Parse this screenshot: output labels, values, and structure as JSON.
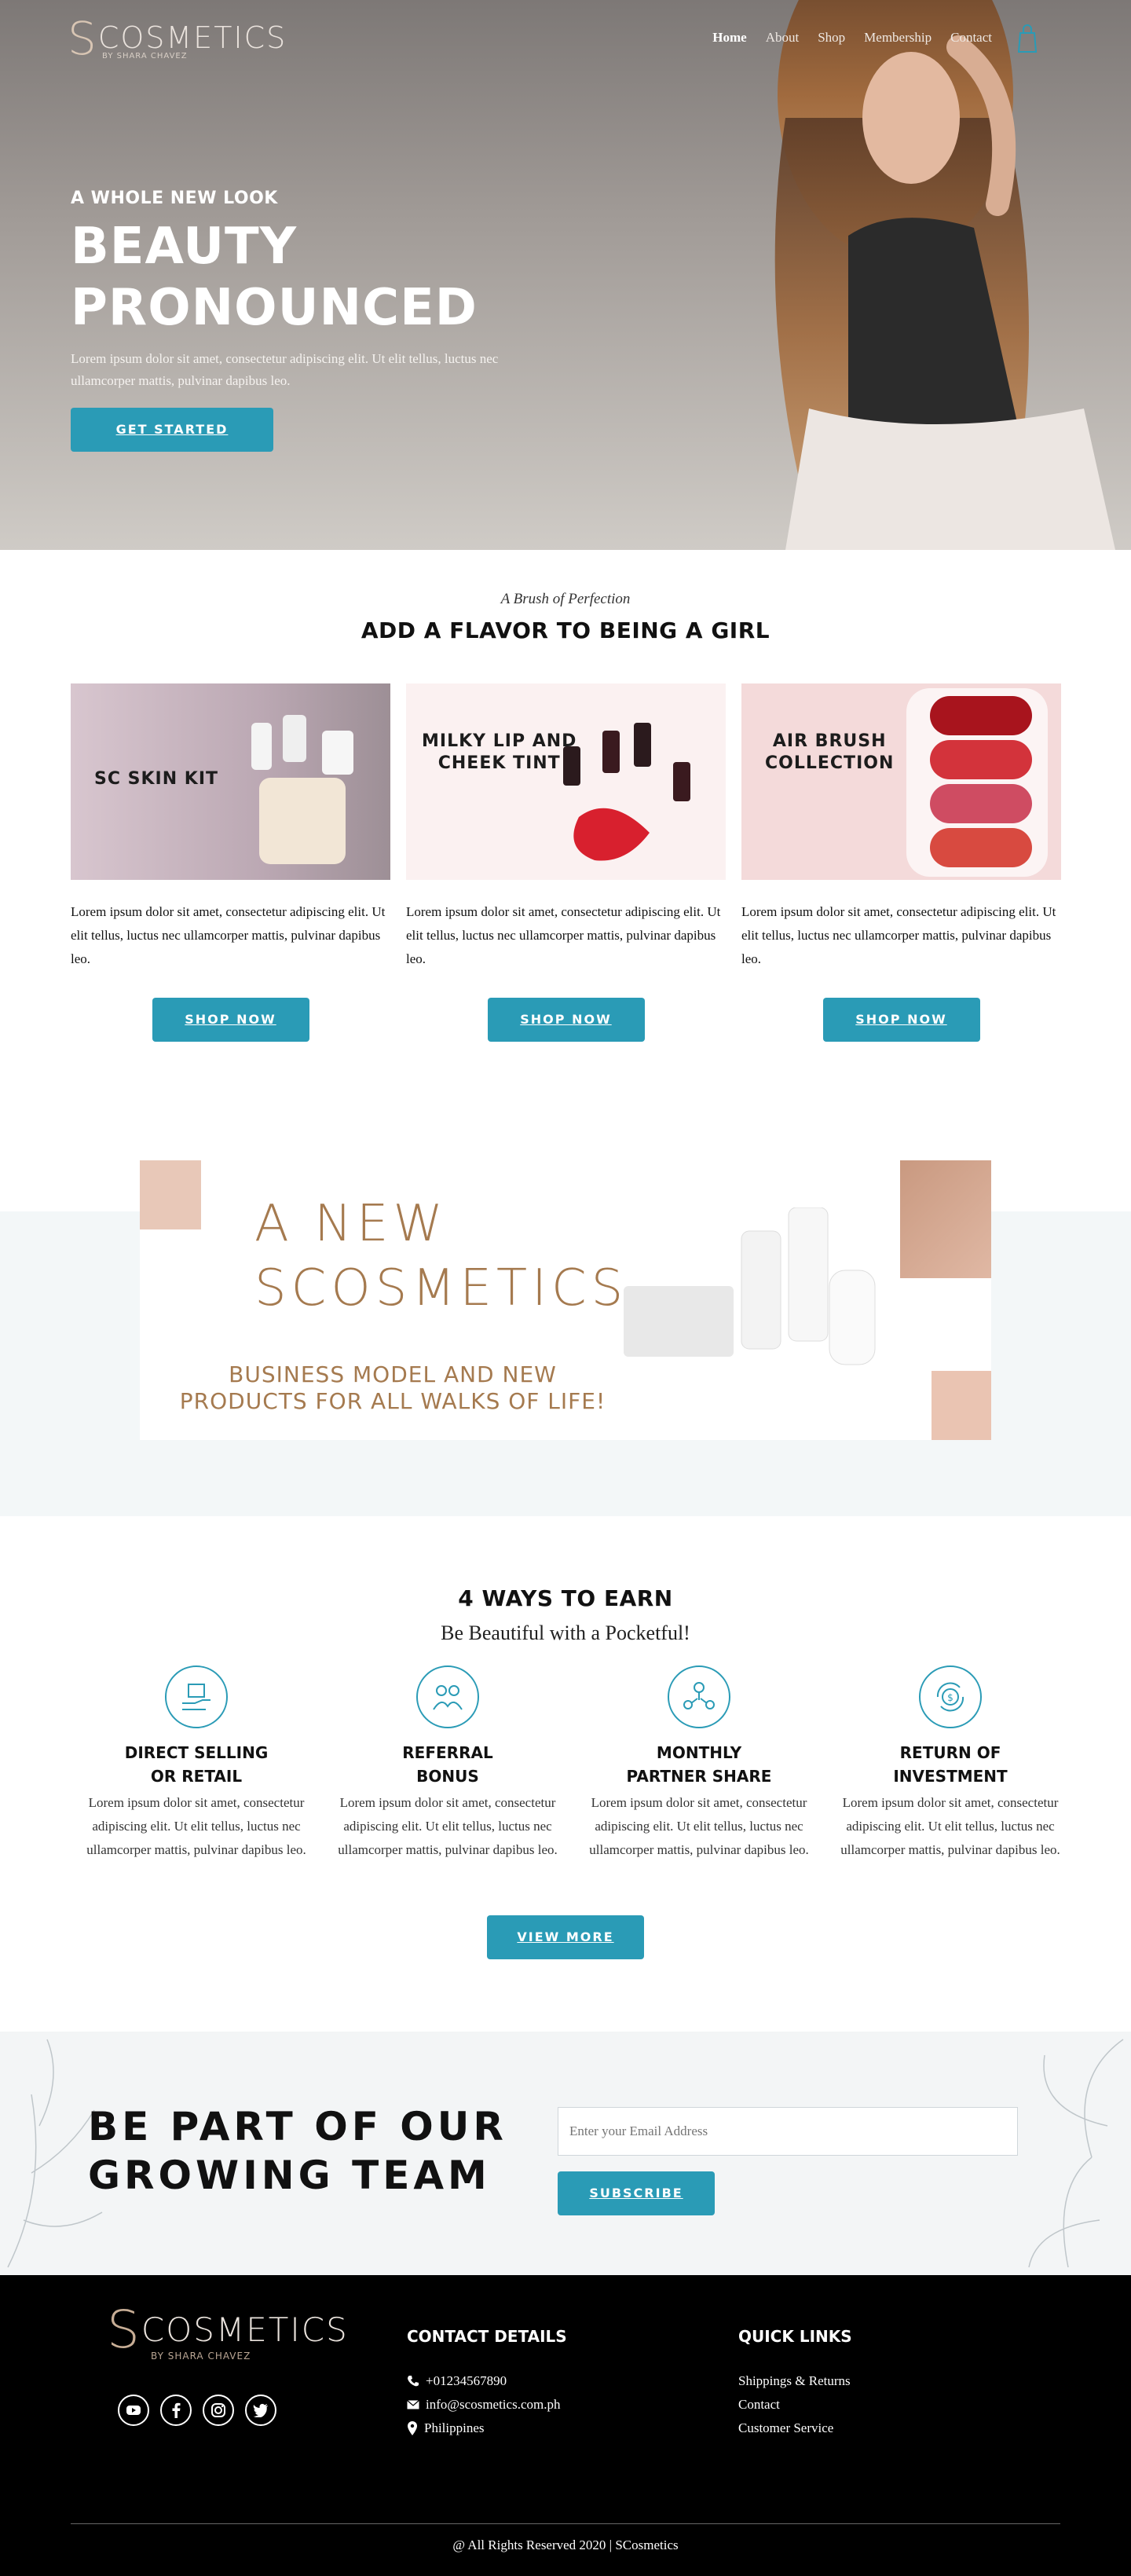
{
  "brand": {
    "logo_main": "COSMETICS",
    "logo_initial": "S",
    "logo_sub": "BY SHARA CHAVEZ"
  },
  "nav": {
    "items": [
      "Home",
      "About",
      "Shop",
      "Membership",
      "Contact"
    ],
    "active": "Home"
  },
  "hero": {
    "eyebrow": "A WHOLE NEW LOOK",
    "title_line1": "BEAUTY",
    "title_line2": "PRONOUNCED",
    "copy": "Lorem ipsum dolor sit amet, consectetur adipiscing elit. Ut elit tellus, luctus nec ullamcorper mattis, pulvinar dapibus leo.",
    "cta": "GET STARTED"
  },
  "flavor": {
    "script": "A Brush of Perfection",
    "title": "ADD A FLAVOR TO BEING A GIRL",
    "cards": [
      {
        "caption": "SC SKIN KIT",
        "text": "Lorem ipsum dolor sit amet, consectetur adipiscing elit. Ut elit tellus, luctus nec ullamcorper mattis, pulvinar dapibus leo.",
        "cta": "SHOP NOW"
      },
      {
        "caption_line1": "MILKY LIP AND",
        "caption_line2": "CHEEK TINT",
        "text": "Lorem ipsum dolor sit amet, consectetur adipiscing elit. Ut elit tellus, luctus nec ullamcorper mattis, pulvinar dapibus leo.",
        "cta": "SHOP NOW"
      },
      {
        "caption_line1": "AIR BRUSH",
        "caption_line2": "COLLECTION",
        "text": "Lorem ipsum dolor sit amet, consectetur adipiscing elit. Ut elit tellus, luctus nec ullamcorper mattis, pulvinar dapibus leo.",
        "cta": "SHOP NOW"
      }
    ]
  },
  "promo": {
    "title_line1": "A NEW",
    "title_line2": "SCOSMETICS",
    "sub_line1": "BUSINESS MODEL AND NEW",
    "sub_line2": "PRODUCTS FOR ALL WALKS OF LIFE!"
  },
  "ways": {
    "title": "4 WAYS TO EARN",
    "subtitle": "Be Beautiful with a Pocketful!",
    "items": [
      {
        "icon": "box-hand-icon",
        "title": "DIRECT SELLING OR RETAIL",
        "text": "Lorem ipsum dolor sit amet, consectetur adipiscing elit. Ut elit tellus, luctus nec ullamcorper mattis, pulvinar dapibus leo."
      },
      {
        "icon": "people-referral-icon",
        "title": "REFERRAL BONUS",
        "text": "Lorem ipsum dolor sit amet, consectetur adipiscing elit. Ut elit tellus, luctus nec ullamcorper mattis, pulvinar dapibus leo."
      },
      {
        "icon": "partner-share-icon",
        "title": "MONTHLY PARTNER SHARE",
        "text": "Lorem ipsum dolor sit amet, consectetur adipiscing elit. Ut elit tellus, luctus nec ullamcorper mattis, pulvinar dapibus leo."
      },
      {
        "icon": "coin-return-icon",
        "title": "RETURN OF INVESTMENT",
        "text": "Lorem ipsum dolor sit amet, consectetur adipiscing elit. Ut elit tellus, luctus nec ullamcorper mattis, pulvinar dapibus leo."
      }
    ],
    "cta": "VIEW MORE"
  },
  "team": {
    "title_line1": "BE PART OF OUR",
    "title_line2": "GROWING TEAM",
    "email_placeholder": "Enter your Email Address",
    "cta": "SUBSCRIBE"
  },
  "footer": {
    "contact_head": "CONTACT DETAILS",
    "phone": "+01234567890",
    "email": "info@scosmetics.com.ph",
    "location": "Philippines",
    "links_head": "QUICK LINKS",
    "links": [
      "Shippings & Returns",
      "Contact",
      "Customer Service"
    ],
    "copyright": "@ All Rights Reserved 2020 | SCosmetics",
    "socials": [
      "youtube-icon",
      "facebook-icon",
      "instagram-icon",
      "twitter-icon"
    ]
  },
  "colors": {
    "accent": "#2a9bb6",
    "promo_brown": "#a57a4f",
    "footer_bg": "#000000"
  }
}
